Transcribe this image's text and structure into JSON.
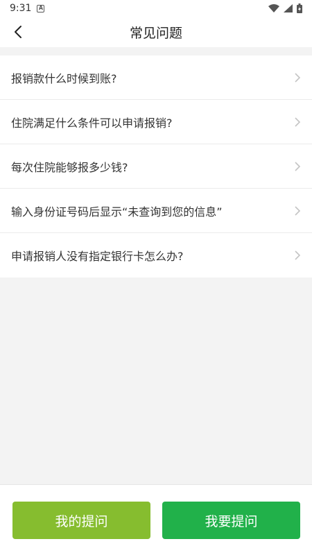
{
  "status_bar": {
    "time": "9:31",
    "notification_icon": "a-icon"
  },
  "header": {
    "title": "常见问题"
  },
  "faq": {
    "items": [
      {
        "label": "报销款什么时候到账?"
      },
      {
        "label": "住院满足什么条件可以申请报销?"
      },
      {
        "label": "每次住院能够报多少钱?"
      },
      {
        "label": "输入身份证号码后显示“未查询到您的信息”"
      },
      {
        "label": "申请报销人没有指定银行卡怎么办?"
      }
    ]
  },
  "actions": {
    "my_questions_label": "我的提问",
    "ask_label": "我要提问"
  },
  "colors": {
    "primary_light_green": "#86bd2f",
    "primary_green": "#21b14a",
    "background": "#f3f3f3"
  }
}
